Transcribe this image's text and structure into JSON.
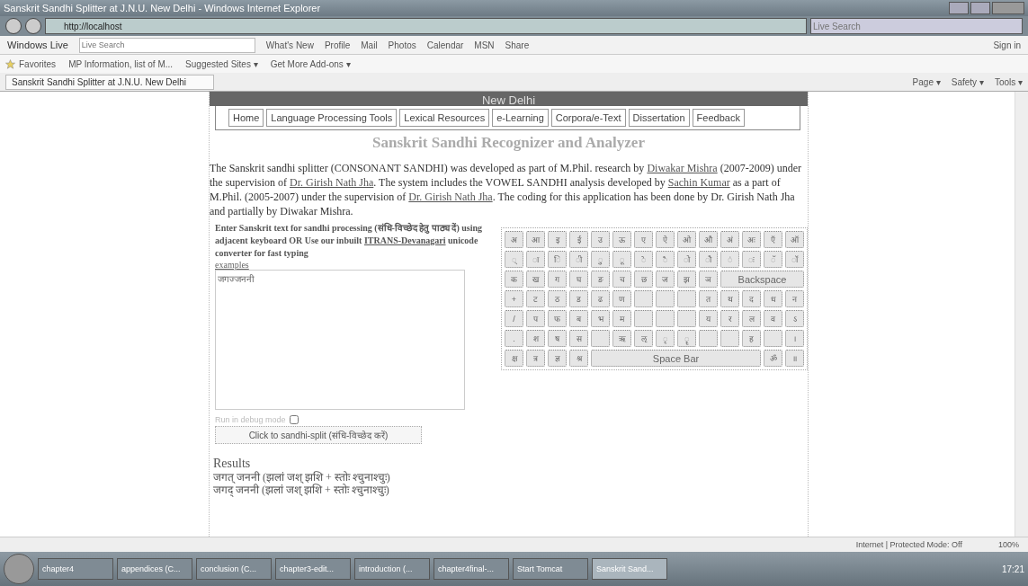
{
  "window": {
    "title": "Sanskrit Sandhi Splitter at J.N.U. New Delhi - Windows Internet Explorer"
  },
  "address_bar": {
    "url": "http://localhost",
    "search_placeholder": "Live Search"
  },
  "live_toolbar": {
    "brand": "Windows Live",
    "search_placeholder": "Live Search",
    "links": [
      "What's New",
      "Profile",
      "Mail",
      "Photos",
      "Calendar",
      "MSN",
      "Share"
    ],
    "sign_in": "Sign in"
  },
  "favorites_bar": {
    "title": "Favorites",
    "items": [
      "MP Information, list of M...",
      "Suggested Sites ▾",
      "Get More Add-ons ▾"
    ]
  },
  "tab": {
    "title": "Sanskrit Sandhi Splitter at J.N.U. New Delhi"
  },
  "command_bar": [
    "Page ▾",
    "Safety ▾",
    "Tools ▾"
  ],
  "page": {
    "banner": "New Delhi",
    "nav": [
      {
        "label": "Home",
        "selected": false
      },
      {
        "label": "Language Processing Tools",
        "selected": false
      },
      {
        "label": "Lexical Resources",
        "selected": false
      },
      {
        "label": "e-Learning",
        "selected": false
      },
      {
        "label": "Corpora/e-Text",
        "selected": false
      },
      {
        "label": "Dissertation",
        "selected": false
      },
      {
        "label": "Feedback",
        "selected": false
      }
    ],
    "heading": "Sanskrit Sandhi Recognizer and Analyzer",
    "intro": [
      {
        "text": "The Sanskrit sandhi splitter (CONSONANT SANDHI) was developed as part of M.Phil. research by ",
        "link": false
      },
      {
        "text": "Diwakar Mishra",
        "link": true
      },
      {
        "text": " (2007-2009) under the supervision of ",
        "link": false
      },
      {
        "text": "Dr. Girish Nath Jha",
        "link": true
      },
      {
        "text": ". The system includes the VOWEL SANDHI analysis developed by ",
        "link": false
      },
      {
        "text": "Sachin Kumar",
        "link": true
      },
      {
        "text": " as a part of M.Phil. (2005-2007) under the supervision of ",
        "link": false
      },
      {
        "text": "Dr. Girish Nath Jha",
        "link": true
      },
      {
        "text": ". The coding for this application has been done by Dr. Girish Nath Jha and partially by Diwakar Mishra.",
        "link": false
      }
    ],
    "instructions": [
      {
        "text": "Enter Sanskrit text for sandhi processing (संधि-विच्छेद हेतु पाठ्य दें) using adjacent keyboard OR Use our inbuilt ",
        "link": false
      },
      {
        "text": "ITRANS-Devanagari",
        "link": true
      },
      {
        "text": " unicode converter for fast typing",
        "link": false
      }
    ],
    "examples_link": "examples",
    "input_value": "जगज्जननी",
    "debug": {
      "label": "Run in debug mode",
      "checked": false
    },
    "split_button": "Click to sandhi-split (संधि-विच्छेद करें)",
    "keyboard": [
      [
        {
          "label": "अ"
        },
        {
          "label": "आ"
        },
        {
          "label": "इ"
        },
        {
          "label": "ई"
        },
        {
          "label": "उ"
        },
        {
          "label": "ऊ"
        },
        {
          "label": "ए"
        },
        {
          "label": "ऐ"
        },
        {
          "label": "ओ"
        },
        {
          "label": "औ"
        },
        {
          "label": "अं"
        },
        {
          "label": "अः"
        },
        {
          "label": "ऍ"
        },
        {
          "label": "ऑ"
        }
      ],
      [
        {
          "label": "्"
        },
        {
          "label": "ा"
        },
        {
          "label": "ि"
        },
        {
          "label": "ी"
        },
        {
          "label": "ु"
        },
        {
          "label": "ू"
        },
        {
          "label": "े"
        },
        {
          "label": "ै"
        },
        {
          "label": "ो"
        },
        {
          "label": "ौ"
        },
        {
          "label": "ं"
        },
        {
          "label": "ः"
        },
        {
          "label": "ॅ"
        },
        {
          "label": "ॉ"
        }
      ],
      [
        {
          "label": "क"
        },
        {
          "label": "ख"
        },
        {
          "label": "ग"
        },
        {
          "label": "घ"
        },
        {
          "label": "ङ"
        },
        {
          "label": "च"
        },
        {
          "label": "छ"
        },
        {
          "label": "ज"
        },
        {
          "label": "झ"
        },
        {
          "label": "ञ"
        },
        {
          "label": "Backspace",
          "kind": "wide"
        }
      ],
      [
        {
          "label": "+"
        },
        {
          "label": "ट"
        },
        {
          "label": "ठ"
        },
        {
          "label": "ड"
        },
        {
          "label": "ढ"
        },
        {
          "label": "ण"
        },
        {
          "kind": "blank"
        },
        {
          "kind": "blank"
        },
        {
          "kind": "blank"
        },
        {
          "label": "त"
        },
        {
          "label": "थ"
        },
        {
          "label": "द"
        },
        {
          "label": "ध"
        },
        {
          "label": "न"
        }
      ],
      [
        {
          "label": "/"
        },
        {
          "label": "प"
        },
        {
          "label": "फ"
        },
        {
          "label": "ब"
        },
        {
          "label": "भ"
        },
        {
          "label": "म"
        },
        {
          "kind": "blank"
        },
        {
          "kind": "blank"
        },
        {
          "kind": "blank"
        },
        {
          "label": "य"
        },
        {
          "label": "र"
        },
        {
          "label": "ल"
        },
        {
          "label": "व"
        },
        {
          "label": "ऽ"
        }
      ],
      [
        {
          "label": "."
        },
        {
          "label": "श"
        },
        {
          "label": "ष"
        },
        {
          "label": "स"
        },
        {
          "kind": "blank"
        },
        {
          "label": "ऋ"
        },
        {
          "label": "ऌ"
        },
        {
          "label": "ृ"
        },
        {
          "label": "ॄ"
        },
        {
          "kind": "blank"
        },
        {
          "kind": "blank"
        },
        {
          "label": "ह"
        },
        {
          "kind": "blank"
        },
        {
          "label": "।"
        }
      ],
      [
        {
          "label": "क्ष"
        },
        {
          "label": "त्र"
        },
        {
          "label": "ज्ञ"
        },
        {
          "label": "श्र"
        },
        {
          "label": "Space Bar",
          "kind": "space"
        },
        {
          "label": "ॐ"
        },
        {
          "label": "॥"
        }
      ]
    ],
    "results_title": "Results",
    "results": [
      "जगत् जननी (झलां जश् झशि + स्तोः श्चुनाश्चुः)",
      "जगद् जननी (झलां जश् झशि + स्तोः श्चुनाश्चुः)"
    ]
  },
  "status_bar": {
    "zone": "Internet | Protected Mode: Off",
    "zoom": "100%"
  },
  "taskbar": {
    "items": [
      {
        "label": "chapter4",
        "selected": false
      },
      {
        "label": "appendices (C...",
        "selected": false
      },
      {
        "label": "conclusion (C...",
        "selected": false
      },
      {
        "label": "chapter3-edit...",
        "selected": false
      },
      {
        "label": "introduction (...",
        "selected": false
      },
      {
        "label": "chapter4final-...",
        "selected": false
      },
      {
        "label": "Start Tomcat",
        "selected": false
      },
      {
        "label": "Sanskrit Sand...",
        "selected": true
      }
    ],
    "clock": "17:21"
  }
}
